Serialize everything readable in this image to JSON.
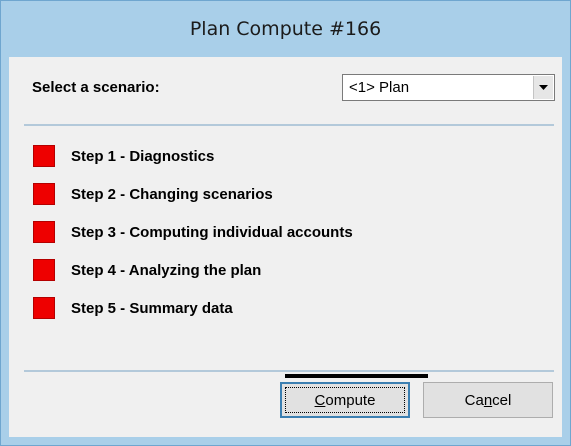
{
  "window": {
    "title": "Plan Compute #166"
  },
  "scenario": {
    "label": "Select a scenario:",
    "selected": "<1> Plan"
  },
  "steps": [
    {
      "label": "Step 1 - Diagnostics",
      "status_color": "#ee0000"
    },
    {
      "label": "Step 2 - Changing scenarios",
      "status_color": "#ee0000"
    },
    {
      "label": "Step 3 - Computing individual accounts",
      "status_color": "#ee0000"
    },
    {
      "label": "Step 4 - Analyzing the plan",
      "status_color": "#ee0000"
    },
    {
      "label": "Step 5 - Summary data",
      "status_color": "#ee0000"
    }
  ],
  "buttons": {
    "compute_first": "C",
    "compute_rest": "ompute",
    "cancel_first": "Ca",
    "cancel_mnemonic": "n",
    "cancel_rest": "cel"
  },
  "icons": {
    "dropdown": "chevron-down-icon",
    "step_status": "status-square-icon"
  }
}
